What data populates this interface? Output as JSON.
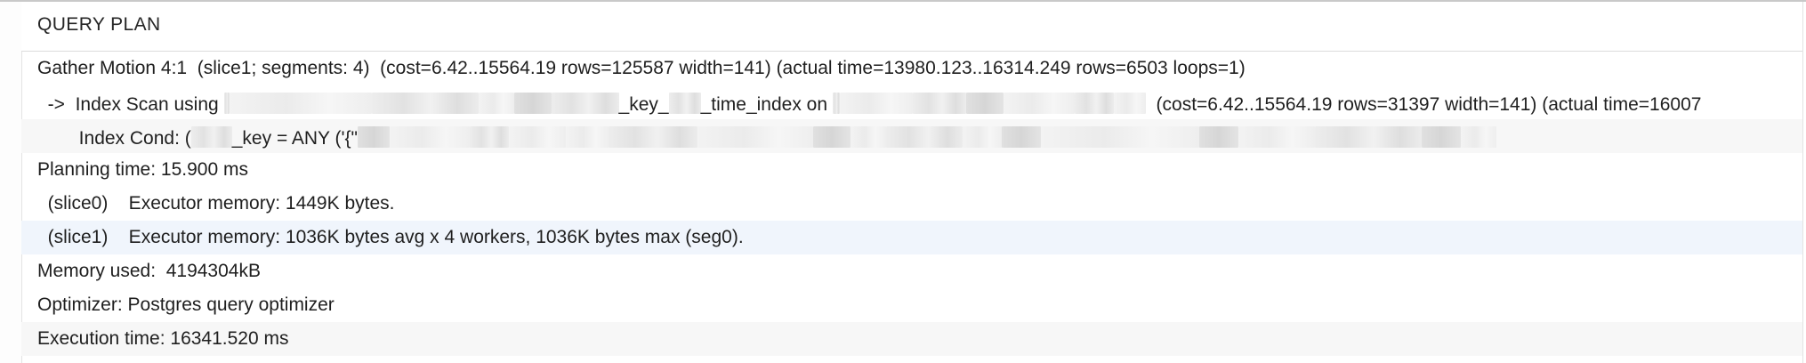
{
  "grid": {
    "header": "QUERY PLAN",
    "rows": [
      {
        "text": "Gather Motion 4:1  (slice1; segments: 4)  (cost=6.42..15564.19 rows=125587 width=141) (actual time=13980.123..16314.249 rows=6503 loops=1)"
      },
      {
        "prefix": "  ->  Index Scan using ",
        "part2": "_key_",
        "part3": "_time_index on ",
        "suffix": "  (cost=6.42..15564.19 rows=31397 width=141) (actual time=16007"
      },
      {
        "prefix": "        Index Cond: (",
        "part2": "_key = ANY ('{\"",
        "suffix": ""
      },
      {
        "text": "Planning time: 15.900 ms"
      },
      {
        "text": "  (slice0)    Executor memory: 1449K bytes."
      },
      {
        "text": "  (slice1)    Executor memory: 1036K bytes avg x 4 workers, 1036K bytes max (seg0)."
      },
      {
        "text": "Memory used:  4194304kB"
      },
      {
        "text": "Optimizer: Postgres query optimizer"
      },
      {
        "text": "Execution time: 16341.520 ms"
      }
    ]
  }
}
